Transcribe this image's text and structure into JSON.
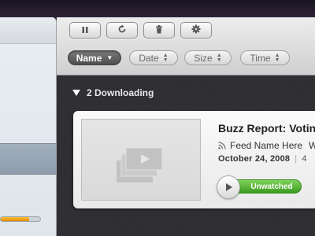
{
  "toolbar": {
    "buttons": [
      {
        "icon": "pause-icon"
      },
      {
        "icon": "refresh-icon"
      },
      {
        "icon": "trash-icon"
      },
      {
        "icon": "gear-icon"
      }
    ],
    "sort": {
      "name": "Name",
      "date": "Date",
      "size": "Size",
      "time": "Time"
    }
  },
  "section": {
    "label": "2 Downloading"
  },
  "item": {
    "title": "Buzz Report: Votin",
    "feed": "Feed Name Here",
    "feed_more": "W",
    "date": "October 24, 2008",
    "size_partial": "4",
    "status": "Unwatched"
  },
  "sidebar": {
    "progress_fraction": 0.72
  },
  "colors": {
    "status_green": "#4caf2a",
    "progress_orange": "#f5a300"
  }
}
